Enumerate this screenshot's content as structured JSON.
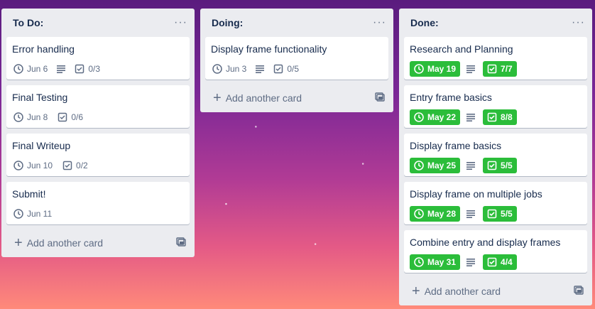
{
  "lists": [
    {
      "title": "To Do:",
      "cards": [
        {
          "title": "Error handling",
          "date": "Jun 6",
          "checklist": "0/3"
        },
        {
          "title": "Final Testing",
          "date": "Jun 8",
          "checklist": "0/6"
        },
        {
          "title": "Final Writeup",
          "date": "Jun 10",
          "checklist": "0/2"
        },
        {
          "title": "Submit!",
          "date": "Jun 11"
        }
      ],
      "add_label": "Add another card"
    },
    {
      "title": "Doing:",
      "cards": [
        {
          "title": "Display frame functionality",
          "date": "Jun 3",
          "checklist": "0/5"
        }
      ],
      "add_label": "Add another card"
    },
    {
      "title": "Done:",
      "cards": [
        {
          "title": "Research and Planning",
          "date": "May 19",
          "checklist": "7/7"
        },
        {
          "title": "Entry frame basics",
          "date": "May 22",
          "checklist": "8/8"
        },
        {
          "title": "Display frame basics",
          "date": "May 25",
          "checklist": "5/5"
        },
        {
          "title": "Display frame on multiple jobs",
          "date": "May 28",
          "checklist": "5/5"
        },
        {
          "title": "Combine entry and display frames",
          "date": "May 31",
          "checklist": "4/4"
        }
      ],
      "add_label": "Add another card"
    }
  ],
  "colors": {
    "complete_badge": "#2bbd3a",
    "list_bg": "#ebecf0"
  }
}
